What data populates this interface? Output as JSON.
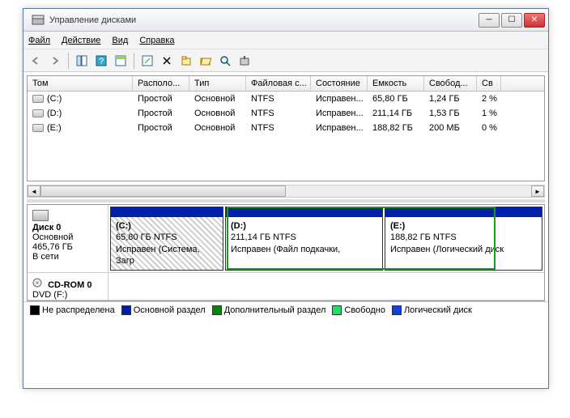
{
  "window": {
    "title": "Управление дисками"
  },
  "menu": {
    "file": "Файл",
    "action": "Действие",
    "view": "Вид",
    "help": "Справка"
  },
  "table": {
    "headers": [
      "Том",
      "Располо...",
      "Тип",
      "Файловая с...",
      "Состояние",
      "Емкость",
      "Свобод...",
      "Св"
    ],
    "rows": [
      {
        "vol": "(C:)",
        "layout": "Простой",
        "type": "Основной",
        "fs": "NTFS",
        "status": "Исправен...",
        "cap": "65,80 ГБ",
        "free": "1,24 ГБ",
        "pct": "2 %"
      },
      {
        "vol": "(D:)",
        "layout": "Простой",
        "type": "Основной",
        "fs": "NTFS",
        "status": "Исправен...",
        "cap": "211,14 ГБ",
        "free": "1,53 ГБ",
        "pct": "1 %"
      },
      {
        "vol": "(E:)",
        "layout": "Простой",
        "type": "Основной",
        "fs": "NTFS",
        "status": "Исправен...",
        "cap": "188,82 ГБ",
        "free": "200 МБ",
        "pct": "0 %"
      }
    ]
  },
  "disks": {
    "disk0": {
      "name": "Диск 0",
      "type": "Основной",
      "size": "465,76 ГБ",
      "status": "В сети"
    },
    "cdrom": {
      "name": "CD-ROM 0",
      "sub": "DVD (F:)"
    },
    "parts": [
      {
        "vol": "(C:)",
        "size": "65,80 ГБ NTFS",
        "status": "Исправен (Система, Загр"
      },
      {
        "vol": "(D:)",
        "size": "211,14 ГБ NTFS",
        "status": "Исправен (Файл подкачки,"
      },
      {
        "vol": "(E:)",
        "size": "188,82 ГБ NTFS",
        "status": "Исправен (Логический диск"
      }
    ]
  },
  "legend": {
    "unalloc": "Не распределена",
    "primary": "Основной раздел",
    "extended": "Дополнительный раздел",
    "free": "Свободно",
    "logical": "Логический диск"
  },
  "colors": {
    "unalloc": "#000000",
    "primary": "#0020aa",
    "extended": "#008800",
    "free": "#22dd66",
    "logical": "#1040dd"
  }
}
